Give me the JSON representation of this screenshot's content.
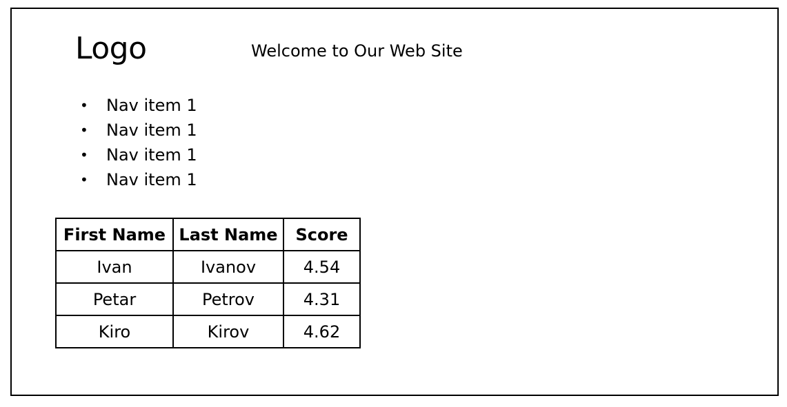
{
  "header": {
    "logo": "Logo",
    "welcome": "Welcome to Our Web Site"
  },
  "nav": {
    "bullet": "•",
    "items": [
      {
        "label": "Nav item 1"
      },
      {
        "label": "Nav item 1"
      },
      {
        "label": "Nav item 1"
      },
      {
        "label": "Nav item 1"
      }
    ]
  },
  "table": {
    "headers": [
      "First Name",
      "Last Name",
      "Score"
    ],
    "rows": [
      [
        "Ivan",
        "Ivanov",
        "4.54"
      ],
      [
        "Petar",
        "Petrov",
        "4.31"
      ],
      [
        "Kiro",
        "Kirov",
        "4.62"
      ]
    ]
  }
}
